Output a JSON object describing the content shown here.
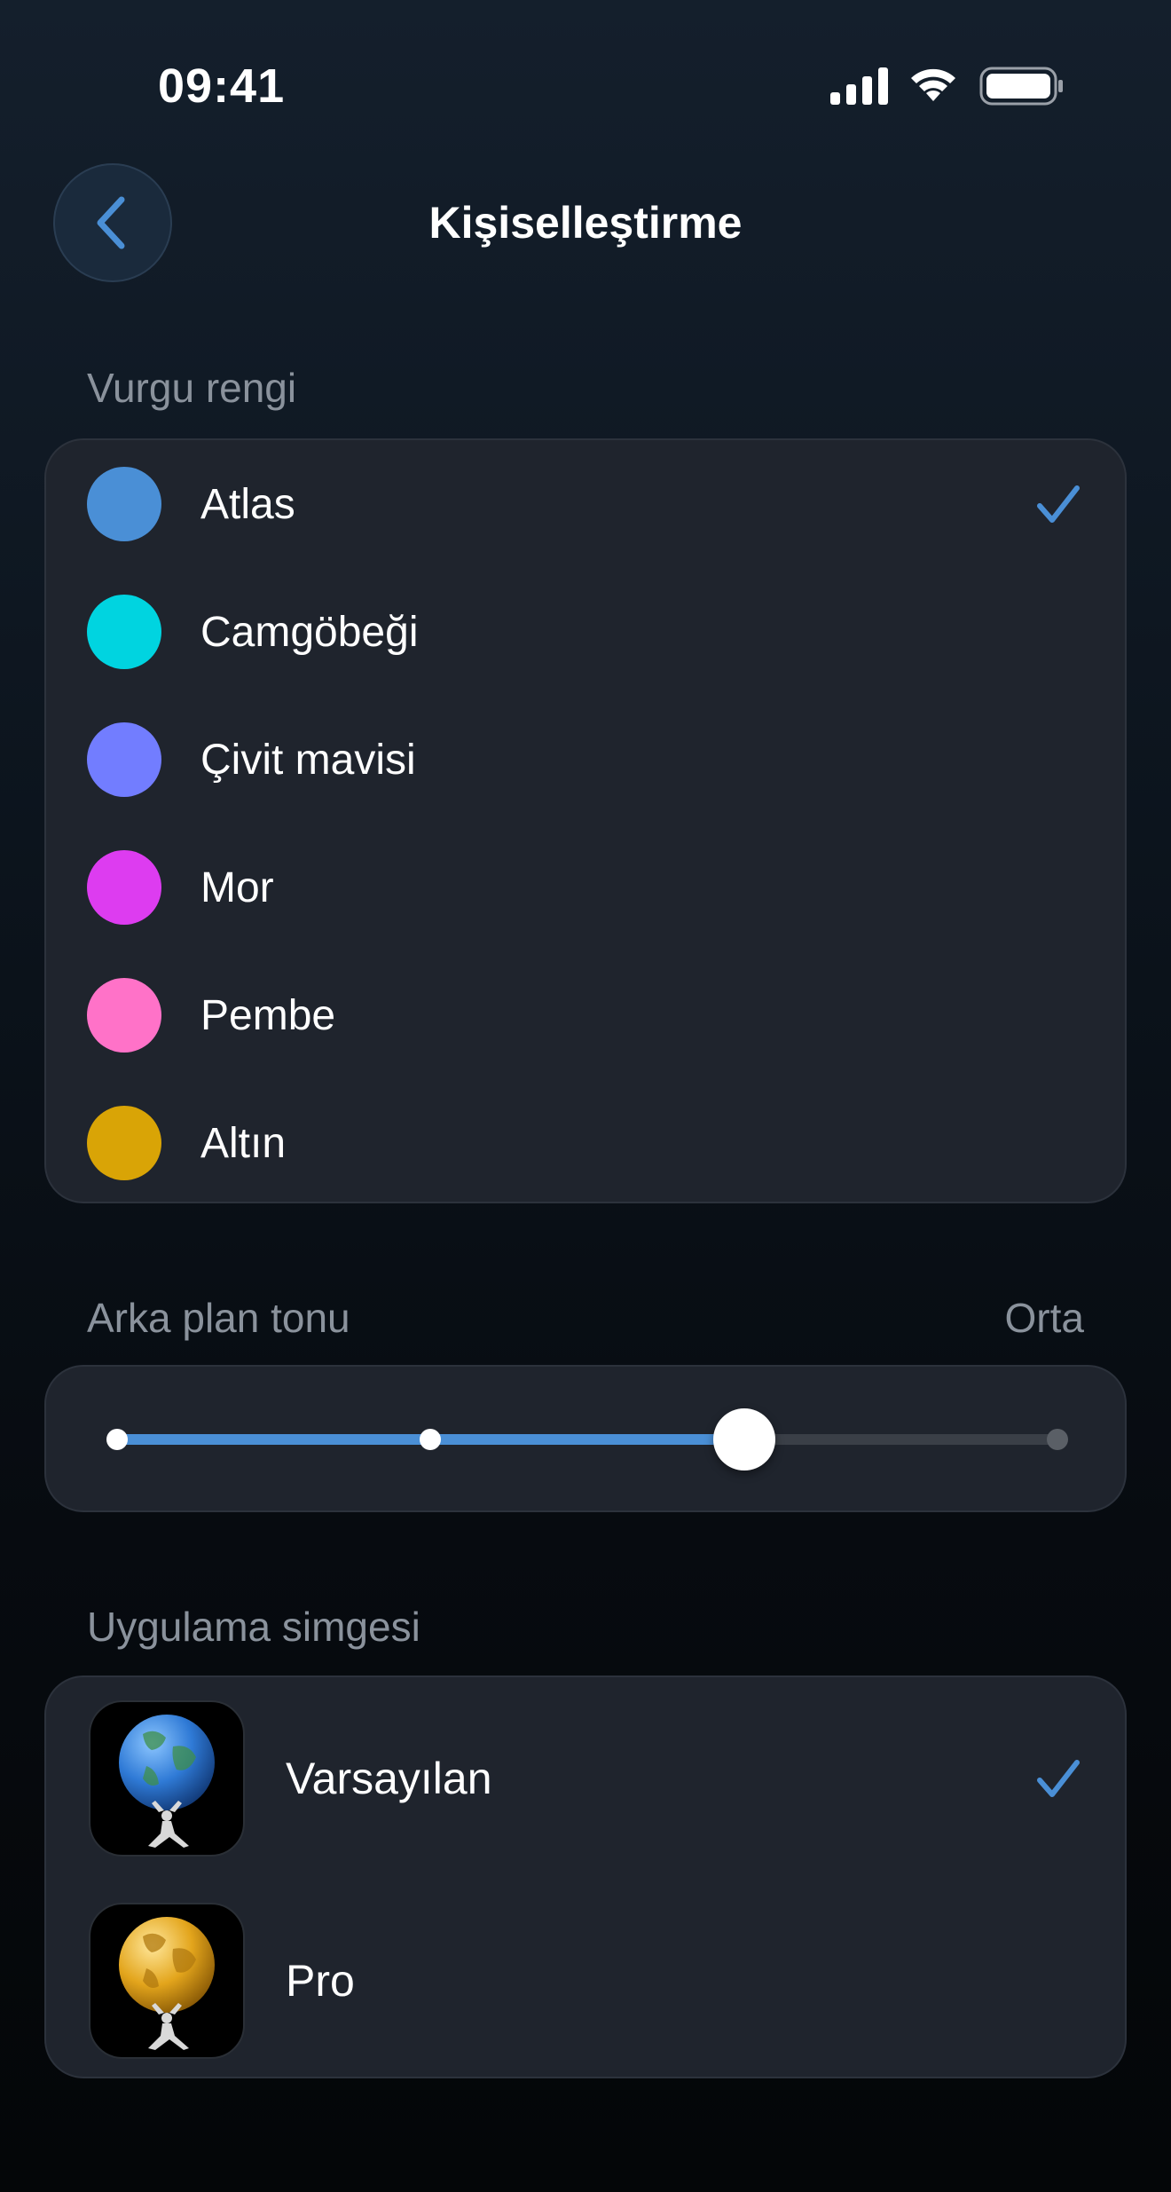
{
  "status_bar": {
    "time": "09:41",
    "icons": [
      "signal-icon",
      "wifi-icon",
      "battery-icon"
    ]
  },
  "nav": {
    "back_icon": "chevron-left-icon",
    "title": "Kişiselleştirme"
  },
  "accent_section": {
    "label": "Vurgu rengi",
    "selected": "Atlas",
    "options": [
      {
        "label": "Atlas",
        "color": "#4a8fd6",
        "selected": true
      },
      {
        "label": "Camgöbeği",
        "color": "#00d4e0",
        "selected": false
      },
      {
        "label": "Çivit mavisi",
        "color": "#727dff",
        "selected": false
      },
      {
        "label": "Mor",
        "color": "#dd3cf0",
        "selected": false
      },
      {
        "label": "Pembe",
        "color": "#ff72c8",
        "selected": false
      },
      {
        "label": "Altın",
        "color": "#d9a406",
        "selected": false
      }
    ]
  },
  "background_section": {
    "label": "Arka plan tonu",
    "value_label": "Orta",
    "stops": 4,
    "selected_stop": 3,
    "fill_color": "#4a8fd6"
  },
  "app_icon_section": {
    "label": "Uygulama simgesi",
    "options": [
      {
        "label": "Varsayılan",
        "icon": "atlas-globe-blue-icon",
        "selected": true
      },
      {
        "label": "Pro",
        "icon": "atlas-globe-gold-icon",
        "selected": false
      }
    ]
  },
  "colors": {
    "accent": "#4a8fd6",
    "card_bg": "#1f242d",
    "secondary_text": "#8a929c"
  }
}
